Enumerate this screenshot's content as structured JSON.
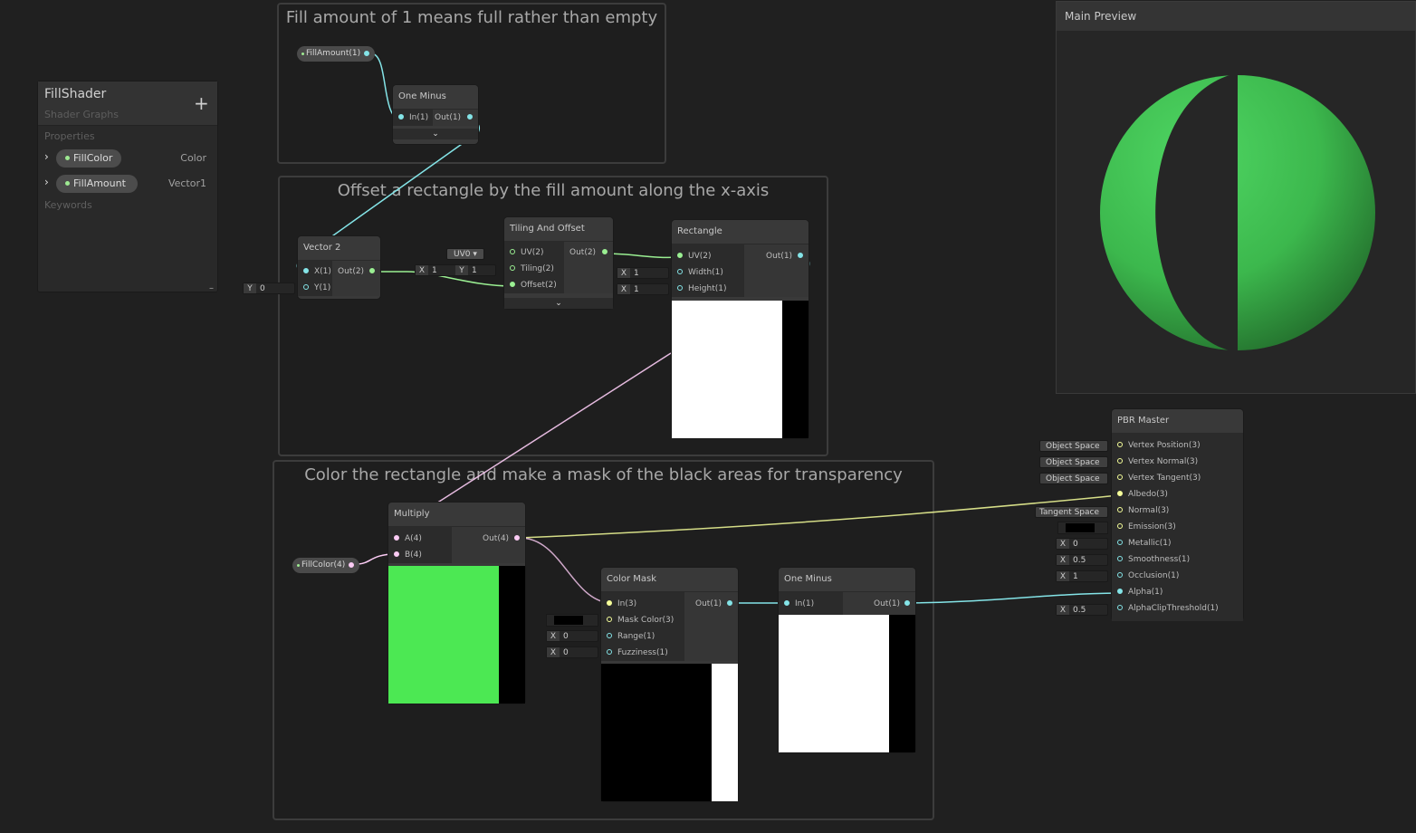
{
  "blackboard": {
    "title": "FillShader",
    "subtitle": "Shader Graphs",
    "add_icon": "+",
    "properties_label": "Properties",
    "properties": [
      {
        "name": "FillColor",
        "type": "Color"
      },
      {
        "name": "FillAmount",
        "type": "Vector1"
      }
    ],
    "keywords_label": "Keywords",
    "resize_icon": "–"
  },
  "groups": {
    "g1": "Fill amount of 1 means full rather than empty",
    "g2": "Offset a rectangle by the fill amount along the x-axis",
    "g3": "Color the rectangle and make a mask of the black areas for transparency"
  },
  "property_nodes": {
    "fill_amount": "FillAmount(1)",
    "fill_color": "FillColor(4)"
  },
  "nodes": {
    "one_minus_top": {
      "title": "One Minus",
      "in": "In(1)",
      "out": "Out(1)"
    },
    "vector2": {
      "title": "Vector 2",
      "in1": "X(1)",
      "in2": "Y(1)",
      "out": "Out(2)"
    },
    "tiling": {
      "title": "Tiling And Offset",
      "in1": "UV(2)",
      "in2": "Tiling(2)",
      "in3": "Offset(2)",
      "out": "Out(2)"
    },
    "rectangle": {
      "title": "Rectangle",
      "in1": "UV(2)",
      "in2": "Width(1)",
      "in3": "Height(1)",
      "out": "Out(1)"
    },
    "multiply": {
      "title": "Multiply",
      "in1": "A(4)",
      "in2": "B(4)",
      "out": "Out(4)"
    },
    "color_mask": {
      "title": "Color Mask",
      "in1": "In(3)",
      "in2": "Mask Color(3)",
      "in3": "Range(1)",
      "in4": "Fuzziness(1)",
      "out": "Out(1)"
    },
    "one_minus_bottom": {
      "title": "One Minus",
      "in": "In(1)",
      "out": "Out(1)"
    },
    "pbr": {
      "title": "PBR Master",
      "inputs": [
        "Vertex Position(3)",
        "Vertex Normal(3)",
        "Vertex Tangent(3)",
        "Albedo(3)",
        "Normal(3)",
        "Emission(3)",
        "Metallic(1)",
        "Smoothness(1)",
        "Occlusion(1)",
        "Alpha(1)",
        "AlphaClipThreshold(1)"
      ]
    }
  },
  "fields": {
    "vec2_y": {
      "label": "Y",
      "value": "0"
    },
    "uv_select": "UV0",
    "tiling_x": {
      "label": "X",
      "value": "1"
    },
    "tiling_y": {
      "label": "Y",
      "value": "1"
    },
    "rect_width": {
      "label": "X",
      "value": "1"
    },
    "rect_height": {
      "label": "X",
      "value": "1"
    },
    "mask_range": {
      "label": "X",
      "value": "0"
    },
    "mask_fuzz": {
      "label": "X",
      "value": "0"
    },
    "pbr_space1": "Object Space",
    "pbr_space2": "Object Space",
    "pbr_space3": "Object Space",
    "pbr_space4": "Tangent Space",
    "pbr_metallic": {
      "label": "X",
      "value": "0"
    },
    "pbr_smooth": {
      "label": "X",
      "value": "0.5"
    },
    "pbr_occlusion": {
      "label": "X",
      "value": "1"
    },
    "pbr_clip": {
      "label": "X",
      "value": "0.5"
    }
  },
  "main_preview": {
    "title": "Main Preview"
  },
  "colors": {
    "background": "#202020",
    "fill_color": "#4ce853",
    "wire_v1": "#84e4e7",
    "wire_v2": "#9aef92",
    "wire_v3": "#f6ff9a",
    "wire_v4": "#fbcbf4"
  }
}
